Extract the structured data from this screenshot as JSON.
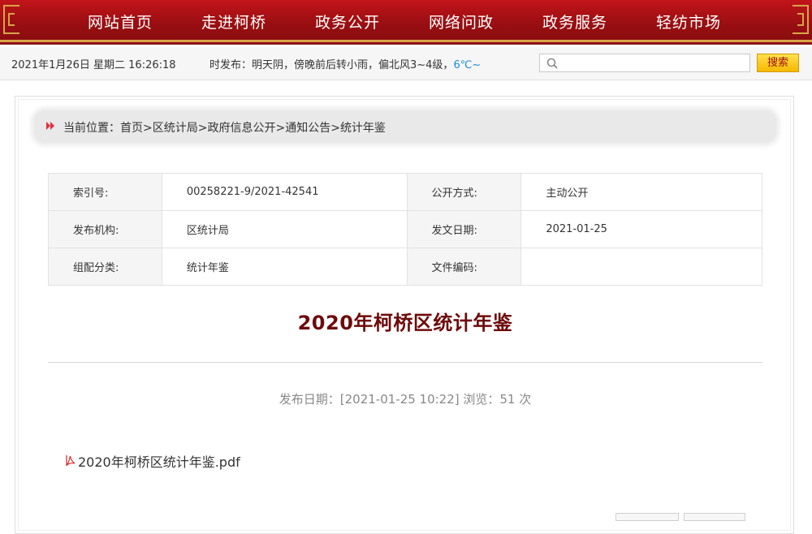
{
  "nav": {
    "items": [
      "网站首页",
      "走进柯桥",
      "政务公开",
      "网络问政",
      "政务服务",
      "轻纺市场"
    ]
  },
  "infobar": {
    "datetime": "2021年1月26日 星期二 16:26:18",
    "weather_prefix": "时发布：明天阴，傍晚前后转小雨，偏北风3~4级，",
    "weather_temp": "6℃~",
    "search_placeholder": "",
    "search_button": "搜索"
  },
  "breadcrumb": {
    "prefix": "当前位置：",
    "items": [
      "首页",
      "区统计局",
      "政府信息公开",
      "通知公告",
      "统计年鉴"
    ],
    "separator": ">"
  },
  "meta": {
    "rows": [
      {
        "k1": "索引号:",
        "v1": "00258221-9/2021-42541",
        "k2": "公开方式:",
        "v2": "主动公开"
      },
      {
        "k1": "发布机构:",
        "v1": "区统计局",
        "k2": "发文日期:",
        "v2": "2021-01-25"
      },
      {
        "k1": "组配分类:",
        "v1": "统计年鉴",
        "k2": "文件编码:",
        "v2": ""
      }
    ]
  },
  "article": {
    "title": "2020年柯桥区统计年鉴",
    "pubinfo": "发布日期：[2021-01-25 10:22] 浏览：51 次",
    "attachment": "2020年柯桥区统计年鉴.pdf"
  },
  "colors": {
    "nav_red": "#9c0f12",
    "gold": "#d8a44a",
    "title_red": "#6e0a0a",
    "search_yellow": "#f5b800"
  }
}
